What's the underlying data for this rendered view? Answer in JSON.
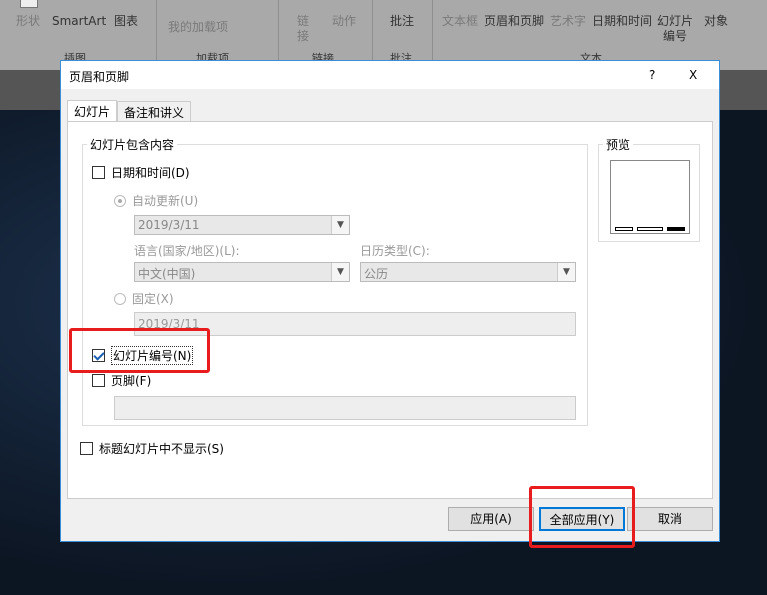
{
  "ribbon": {
    "items": [
      "形状",
      "SmartArt",
      "图表",
      "我的加载项",
      "链接",
      "动作",
      "批注",
      "文本框",
      "页眉和页脚",
      "艺术字",
      "日期和时间",
      "幻灯片编号",
      "对象"
    ],
    "groups": [
      "插图",
      "加载项",
      "链接",
      "批注",
      "文本"
    ]
  },
  "dialog": {
    "title": "页眉和页脚",
    "help": "?",
    "close": "X",
    "tabs": [
      "幻灯片",
      "备注和讲义"
    ],
    "group_label": "幻灯片包含内容",
    "date_time": "日期和时间(D)",
    "auto_update": "自动更新(U)",
    "date_value": "2019/3/11",
    "language_label": "语言(国家/地区)(L):",
    "language_value": "中文(中国)",
    "calendar_label": "日历类型(C):",
    "calendar_value": "公历",
    "fixed": "固定(X)",
    "fixed_value": "2019/3/11",
    "slide_number": "幻灯片编号(N)",
    "footer": "页脚(F)",
    "footer_value": "",
    "hide_title": "标题幻灯片中不显示(S)",
    "preview": "预览",
    "apply": "应用(A)",
    "apply_all": "全部应用(Y)",
    "cancel": "取消"
  },
  "state": {
    "date_time_checked": false,
    "slide_number_checked": true,
    "footer_checked": false,
    "hide_title_checked": false
  }
}
